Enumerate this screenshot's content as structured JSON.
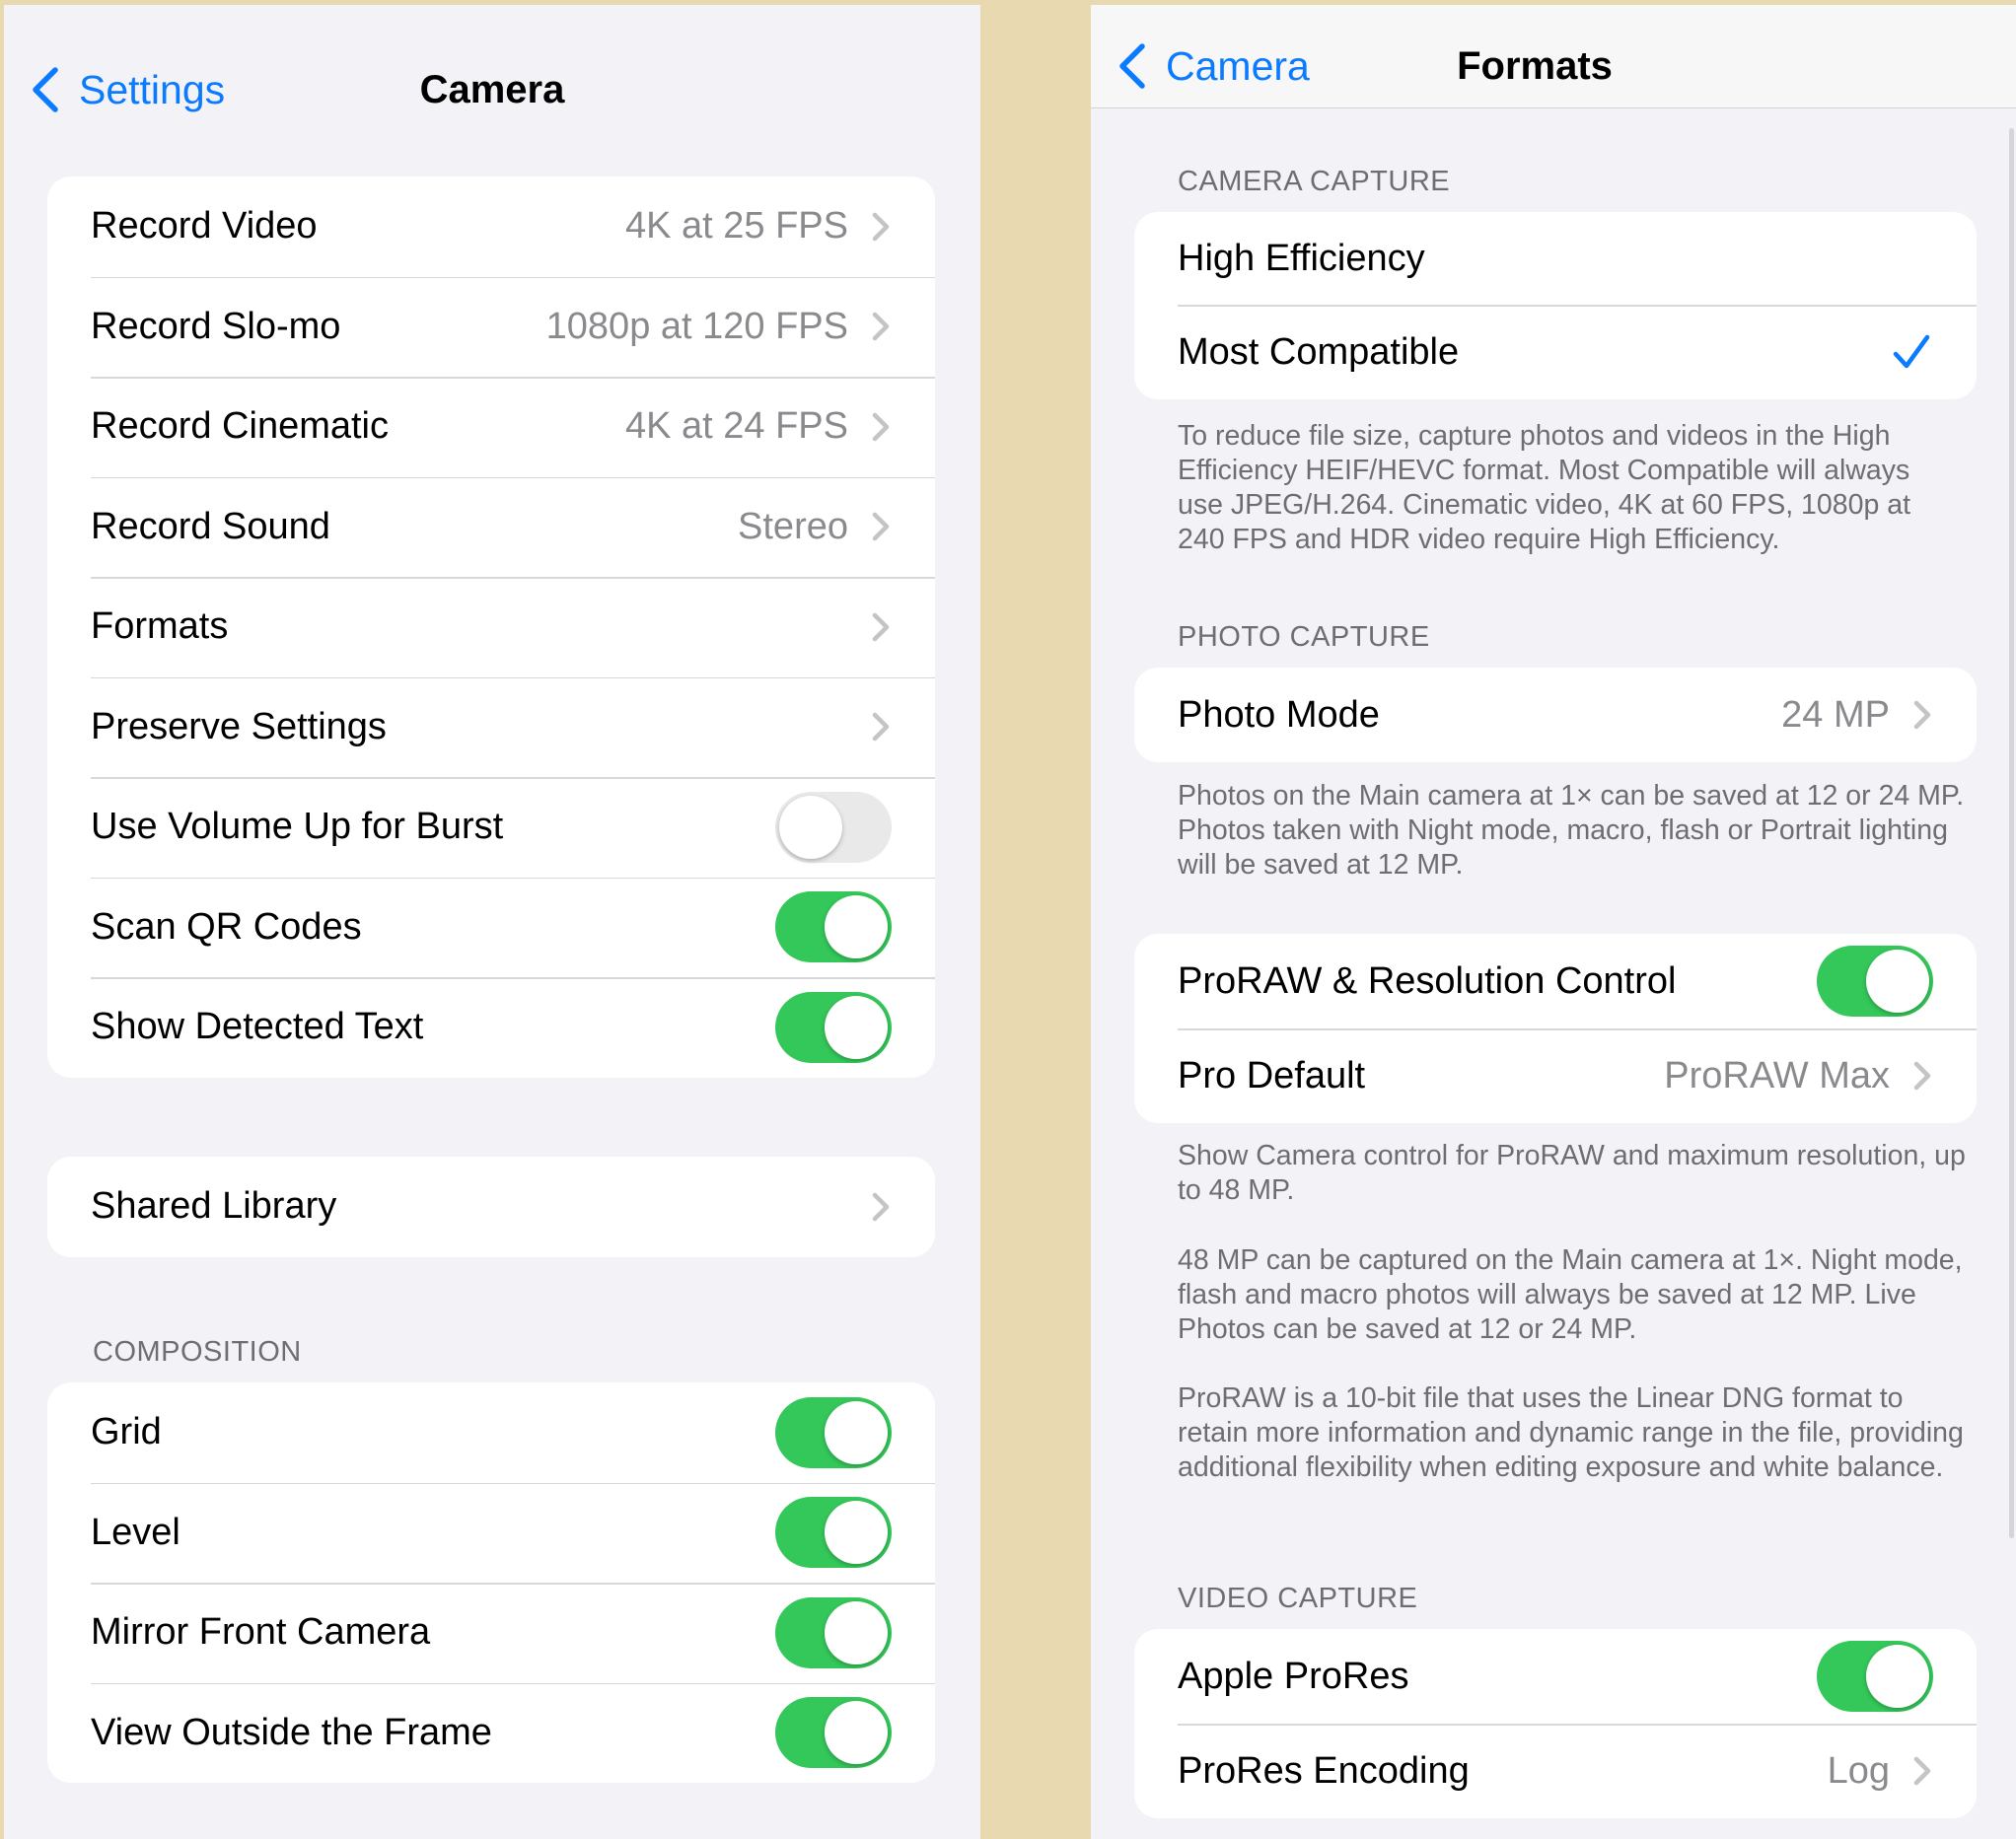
{
  "left": {
    "back_label": "Settings",
    "title": "Camera",
    "group1": [
      {
        "label": "Record Video",
        "value": "4K at 25 FPS",
        "type": "link"
      },
      {
        "label": "Record Slo-mo",
        "value": "1080p at 120 FPS",
        "type": "link"
      },
      {
        "label": "Record Cinematic",
        "value": "4K at 24 FPS",
        "type": "link"
      },
      {
        "label": "Record Sound",
        "value": "Stereo",
        "type": "link"
      },
      {
        "label": "Formats",
        "value": "",
        "type": "link"
      },
      {
        "label": "Preserve Settings",
        "value": "",
        "type": "link"
      },
      {
        "label": "Use Volume Up for Burst",
        "type": "toggle",
        "on": false
      },
      {
        "label": "Scan QR Codes",
        "type": "toggle",
        "on": true
      },
      {
        "label": "Show Detected Text",
        "type": "toggle",
        "on": true
      }
    ],
    "group2": [
      {
        "label": "Shared Library",
        "value": "",
        "type": "link"
      }
    ],
    "composition_header": "COMPOSITION",
    "composition": [
      {
        "label": "Grid",
        "type": "toggle",
        "on": true
      },
      {
        "label": "Level",
        "type": "toggle",
        "on": true
      },
      {
        "label": "Mirror Front Camera",
        "type": "toggle",
        "on": true
      },
      {
        "label": "View Outside the Frame",
        "type": "toggle",
        "on": true
      }
    ]
  },
  "right": {
    "back_label": "Camera",
    "title": "Formats",
    "camera_capture_header": "CAMERA CAPTURE",
    "camera_capture": [
      {
        "label": "High Efficiency",
        "selected": false
      },
      {
        "label": "Most Compatible",
        "selected": true
      }
    ],
    "camera_capture_footer": "To reduce file size, capture photos and videos in the High Efficiency HEIF/HEVC format. Most Compatible will always use JPEG/H.264. Cinematic video, 4K at 60 FPS, 1080p at 240 FPS and HDR video require High Efficiency.",
    "photo_capture_header": "PHOTO CAPTURE",
    "photo_mode": {
      "label": "Photo Mode",
      "value": "24 MP"
    },
    "photo_mode_footer": "Photos on the Main camera at 1× can be saved at 12 or 24 MP. Photos taken with Night mode, macro, flash or Portrait lighting will be saved at 12 MP.",
    "proraw_toggle": {
      "label": "ProRAW & Resolution Control",
      "on": true
    },
    "pro_default": {
      "label": "Pro Default",
      "value": "ProRAW Max"
    },
    "proraw_footer_1": "Show Camera control for ProRAW and maximum resolution, up to 48 MP.",
    "proraw_footer_2": "48 MP can be captured on the Main camera at 1×. Night mode, flash and macro photos will always be saved at 12 MP. Live Photos can be saved at 12 or 24 MP.",
    "proraw_footer_3": "ProRAW is a 10-bit file that uses the Linear DNG format to retain more information and dynamic range in the file, providing additional flexibility when editing exposure and white balance.",
    "video_capture_header": "VIDEO CAPTURE",
    "apple_prores": {
      "label": "Apple ProRes",
      "on": true
    },
    "prores_encoding": {
      "label": "ProRes Encoding",
      "value": "Log"
    }
  },
  "colors": {
    "accent": "#0a7aff",
    "toggle_on": "#34c759",
    "toggle_off": "#e9e9ea",
    "backdrop": "#e8d9b0"
  }
}
